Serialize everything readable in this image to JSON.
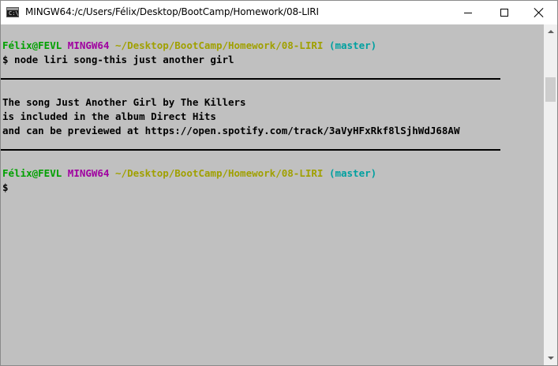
{
  "window": {
    "title": "MINGW64:/c/Users/Félix/Desktop/BootCamp/Homework/08-LIRI",
    "icon": "terminal-icon",
    "controls": [
      "minimize-icon",
      "maximize-icon",
      "close-icon"
    ]
  },
  "terminal": {
    "colors": {
      "background": "#c0c0c0",
      "user_host": "#00a000",
      "msystem": "#a000a0",
      "path": "#a0a000",
      "branch": "#00a0a0",
      "text": "#000000"
    },
    "prompt1": {
      "user_host": "Félix@FEVL",
      "msystem": "MINGW64",
      "path": "~/Desktop/BootCamp/Homework/08-LIRI",
      "branch": "(master)"
    },
    "command": "$ node liri song-this just another girl",
    "output": [
      "The song Just Another Girl by The Killers",
      "is included in the album Direct Hits",
      "and can be previewed at https://open.spotify.com/track/3aVyHFxRkf8lSjhWdJ68AW"
    ],
    "prompt2": {
      "user_host": "Félix@FEVL",
      "msystem": "MINGW64",
      "path": "~/Desktop/BootCamp/Homework/08-LIRI",
      "branch": "(master)"
    },
    "cursor_prompt": "$"
  }
}
